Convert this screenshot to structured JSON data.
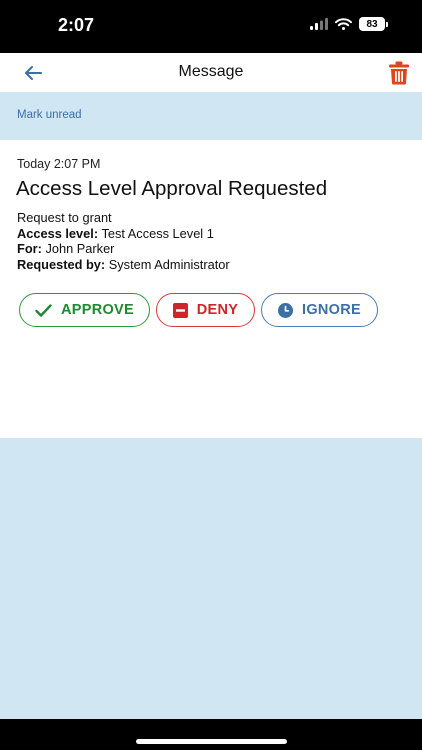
{
  "status_bar": {
    "time": "2:07",
    "battery": "83"
  },
  "header": {
    "title": "Message"
  },
  "toolbar": {
    "mark_unread": "Mark unread"
  },
  "message": {
    "timestamp": "Today 2:07 PM",
    "title": "Access Level Approval Requested",
    "intro": "Request to grant",
    "fields": [
      {
        "label": "Access level:",
        "value": "Test Access Level 1"
      },
      {
        "label": "For:",
        "value": "John Parker"
      },
      {
        "label": "Requested by:",
        "value": "System Administrator"
      }
    ]
  },
  "actions": {
    "approve": "APPROVE",
    "deny": "DENY",
    "ignore": "IGNORE"
  },
  "colors": {
    "approve": "#1f8a32",
    "deny": "#d0242a",
    "ignore": "#3b6fa6",
    "delete": "#e0441a",
    "background": "#d0e6f2"
  },
  "icons": {
    "back": "back-arrow-icon",
    "delete": "trash-icon",
    "approve": "checkmark-icon",
    "deny": "minus-box-icon",
    "ignore": "clock-icon"
  }
}
